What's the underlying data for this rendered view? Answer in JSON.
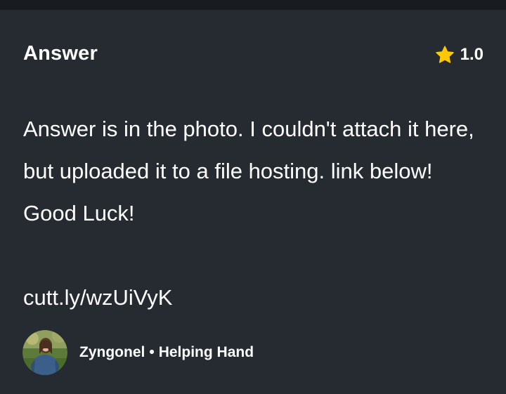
{
  "header": {
    "title": "Answer",
    "rating": "1.0"
  },
  "answer": {
    "body": "Answer is in the photo. I couldn't attach it here, but uploaded it to a file hosting. link below! Good Luck!",
    "link": "cutt.ly/wzUiVyK"
  },
  "author": {
    "name": "Zyngonel",
    "separator": "•",
    "rank": "Helping Hand"
  },
  "colors": {
    "background": "#252b31",
    "top_bar": "#181c20",
    "star": "#ffc800",
    "text": "#ffffff"
  },
  "icons": {
    "rating": "star-icon"
  }
}
